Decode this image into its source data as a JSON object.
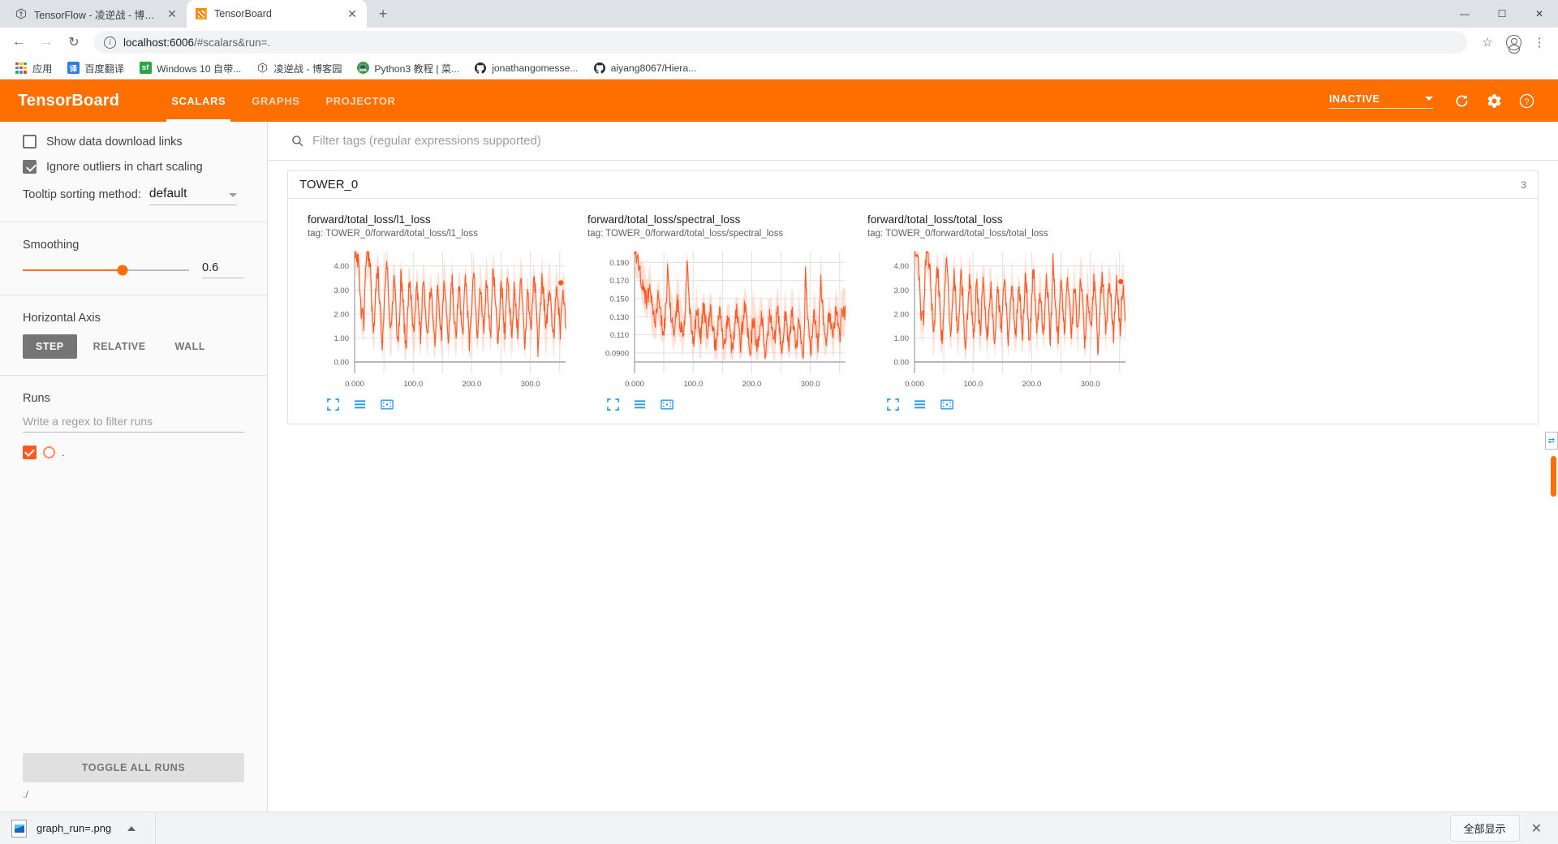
{
  "browser": {
    "tabs": [
      {
        "title": "TensorFlow - 凌逆战 - 博客园",
        "favicon": "tensorflow-icon",
        "active": false
      },
      {
        "title": "TensorBoard",
        "favicon": "tensorboard-icon",
        "active": true
      }
    ],
    "new_tab_label": "+",
    "window_controls": {
      "minimize": "—",
      "maximize": "☐",
      "close": "✕"
    },
    "nav": {
      "back": "←",
      "forward": "→",
      "reload": "↻"
    },
    "omnibox": {
      "url_host": "localhost:6006",
      "url_path": "/#scalars&run=.",
      "info_icon": "info-icon",
      "star_icon": "star-icon",
      "profile_icon": "profile-icon",
      "menu_icon": "kebab-menu-icon"
    },
    "bookmarks": [
      {
        "label": "应用",
        "icon": "apps-grid-icon"
      },
      {
        "label": "百度翻译",
        "icon": "baidu-translate-icon",
        "badge": "译"
      },
      {
        "label": "Windows 10 自带...",
        "icon": "sf-icon",
        "badge": "sf"
      },
      {
        "label": "凌逆战 - 博客园",
        "icon": "tensorflow-icon"
      },
      {
        "label": "Python3 教程 | 菜...",
        "icon": "runoob-icon"
      },
      {
        "label": "jonathangomesse...",
        "icon": "github-icon"
      },
      {
        "label": "aiyang8067/Hiera...",
        "icon": "github-icon"
      }
    ]
  },
  "tensorboard": {
    "logo": "TensorBoard",
    "nav": [
      {
        "label": "SCALARS",
        "active": true
      },
      {
        "label": "GRAPHS",
        "active": false
      },
      {
        "label": "PROJECTOR",
        "active": false
      }
    ],
    "status": "INACTIVE",
    "header_icons": [
      "refresh-icon",
      "settings-gear-icon",
      "help-icon"
    ]
  },
  "sidebar": {
    "checkboxes": [
      {
        "label": "Show data download links",
        "checked": false
      },
      {
        "label": "Ignore outliers in chart scaling",
        "checked": true
      }
    ],
    "tooltip_sorting": {
      "label": "Tooltip sorting method:",
      "value": "default"
    },
    "smoothing": {
      "title": "Smoothing",
      "value": "0.6",
      "percent": 60
    },
    "horizontal_axis": {
      "title": "Horizontal Axis",
      "options": [
        {
          "label": "STEP",
          "active": true
        },
        {
          "label": "RELATIVE",
          "active": false
        },
        {
          "label": "WALL",
          "active": false
        }
      ]
    },
    "runs": {
      "title": "Runs",
      "filter_placeholder": "Write a regex to filter runs",
      "items": [
        {
          "name": ".",
          "checked": true,
          "color": "#ff5722"
        }
      ]
    },
    "toggle_all_label": "TOGGLE ALL RUNS",
    "footer_path": "./"
  },
  "main": {
    "filter_placeholder": "Filter tags (regular expressions supported)",
    "search_icon": "search-icon",
    "card": {
      "title": "TOWER_0",
      "count": "3"
    },
    "chart_tools": [
      "expand-chart-icon",
      "data-series-icon",
      "fit-domain-icon"
    ]
  },
  "chart_data": [
    {
      "type": "line",
      "title": "forward/total_loss/l1_loss",
      "tag": "tag: TOWER_0/forward/total_loss/l1_loss",
      "xlabel": "",
      "ylabel": "",
      "xticks": [
        "0.000",
        "100.0",
        "200.0",
        "300.0"
      ],
      "yticks": [
        "0.00",
        "1.00",
        "2.00",
        "3.00",
        "4.00"
      ],
      "ylim": [
        0.0,
        4.6
      ],
      "xlim": [
        0,
        360
      ],
      "grid": true,
      "legend": false,
      "series_color": "#ff5722",
      "band_color": "#ffccbc",
      "last_point": {
        "x": 352,
        "y": 3.3
      },
      "series": [
        {
          "name": ".",
          "values": [
            4.55,
            4.6,
            4.4,
            4.2,
            3.0,
            1.75,
            2.1,
            1.6,
            3.6,
            4.5,
            4.45,
            4.3,
            3.9,
            2.4,
            1.25,
            1.3,
            2.8,
            3.9,
            3.5,
            2.6,
            1.35,
            0.85,
            1.9,
            3.2,
            4.3,
            3.7,
            2.2,
            1.1,
            1.4,
            2.7,
            3.5,
            2.9,
            1.5,
            0.95,
            1.8,
            3.6,
            3.1,
            2.3,
            1.2,
            0.6,
            1.7,
            2.9,
            3.4,
            2.5,
            1.45,
            1.0,
            2.0,
            3.3,
            2.6,
            1.6,
            1.1,
            2.4,
            3.2,
            2.8,
            1.9,
            1.05,
            1.5,
            2.7,
            3.0,
            2.2,
            1.3,
            0.9,
            2.1,
            3.1,
            2.5,
            1.7,
            1.2,
            2.6,
            3.4,
            2.9,
            1.8,
            0.55,
            1.6,
            2.8,
            3.3,
            2.4,
            1.4,
            0.95,
            2.2,
            3.0,
            2.7,
            1.55,
            1.1,
            2.3,
            3.6,
            2.95,
            1.85,
            0.6,
            1.45,
            2.5,
            3.9,
            3.2,
            2.0,
            1.15,
            1.9,
            3.05,
            2.6,
            1.65,
            1.25,
            2.45,
            3.5,
            2.85,
            1.75,
            1.0,
            2.15,
            4.2,
            3.15,
            2.35,
            1.35,
            0.9,
            2.05,
            3.25,
            2.75,
            1.6,
            1.2,
            2.55,
            3.45,
            2.9,
            1.95,
            1.05,
            1.8,
            3.1,
            2.65,
            1.7,
            1.15,
            2.3,
            3.55,
            3.0,
            2.1,
            0.75,
            1.5,
            2.85,
            2.45,
            1.85,
            1.3,
            2.6,
            3.35,
            2.95,
            2.0,
            0.45,
            1.4,
            2.4,
            3.5,
            3.05,
            2.25,
            1.1,
            1.95,
            2.7,
            3.2,
            2.55,
            1.5,
            0.95,
            2.1,
            3.4,
            2.8,
            1.9,
            1.2,
            2.35,
            3.1,
            2.65,
            1.75
          ]
        }
      ]
    },
    {
      "type": "line",
      "title": "forward/total_loss/spectral_loss",
      "tag": "tag: TOWER_0/forward/total_loss/spectral_loss",
      "xlabel": "",
      "ylabel": "",
      "xticks": [
        "0.000",
        "100.0",
        "200.0",
        "300.0"
      ],
      "yticks": [
        "0.0900",
        "0.110",
        "0.130",
        "0.150",
        "0.170",
        "0.190"
      ],
      "ylim": [
        0.08,
        0.202
      ],
      "xlim": [
        0,
        360
      ],
      "grid": true,
      "legend": false,
      "series_color": "#ff5722",
      "band_color": "#ffccbc",
      "series": [
        {
          "name": ".",
          "values": [
            0.2,
            0.199,
            0.197,
            0.188,
            0.178,
            0.172,
            0.165,
            0.158,
            0.15,
            0.146,
            0.155,
            0.162,
            0.148,
            0.14,
            0.133,
            0.128,
            0.138,
            0.152,
            0.145,
            0.131,
            0.12,
            0.115,
            0.125,
            0.143,
            0.185,
            0.16,
            0.139,
            0.127,
            0.118,
            0.112,
            0.13,
            0.148,
            0.136,
            0.124,
            0.116,
            0.108,
            0.122,
            0.141,
            0.195,
            0.158,
            0.134,
            0.121,
            0.111,
            0.105,
            0.119,
            0.137,
            0.129,
            0.117,
            0.11,
            0.126,
            0.144,
            0.132,
            0.12,
            0.113,
            0.123,
            0.14,
            0.128,
            0.114,
            0.104,
            0.098,
            0.109,
            0.127,
            0.135,
            0.121,
            0.106,
            0.095,
            0.108,
            0.124,
            0.131,
            0.118,
            0.103,
            0.092,
            0.107,
            0.123,
            0.138,
            0.126,
            0.112,
            0.099,
            0.115,
            0.133,
            0.142,
            0.13,
            0.117,
            0.102,
            0.094,
            0.111,
            0.129,
            0.122,
            0.108,
            0.096,
            0.105,
            0.125,
            0.134,
            0.12,
            0.101,
            0.088,
            0.104,
            0.119,
            0.132,
            0.127,
            0.113,
            0.098,
            0.11,
            0.128,
            0.137,
            0.116,
            0.1,
            0.091,
            0.109,
            0.131,
            0.124,
            0.107,
            0.097,
            0.114,
            0.136,
            0.126,
            0.112,
            0.093,
            0.106,
            0.129,
            0.121,
            0.105,
            0.09,
            0.103,
            0.187,
            0.14,
            0.118,
            0.102,
            0.095,
            0.115,
            0.133,
            0.125,
            0.109,
            0.099,
            0.12,
            0.18,
            0.145,
            0.127,
            0.111,
            0.098,
            0.117,
            0.135,
            0.128,
            0.113,
            0.101,
            0.123,
            0.142,
            0.13,
            0.119,
            0.108,
            0.132,
            0.139,
            0.134,
            0.136
          ]
        }
      ]
    },
    {
      "type": "line",
      "title": "forward/total_loss/total_loss",
      "tag": "tag: TOWER_0/forward/total_loss/total_loss",
      "xlabel": "",
      "ylabel": "",
      "xticks": [
        "0.000",
        "100.0",
        "200.0",
        "300.0"
      ],
      "yticks": [
        "0.00",
        "1.00",
        "2.00",
        "3.00",
        "4.00"
      ],
      "ylim": [
        0.0,
        4.6
      ],
      "xlim": [
        0,
        360
      ],
      "grid": true,
      "legend": false,
      "series_color": "#ff5722",
      "band_color": "#ffccbc",
      "last_point": {
        "x": 352,
        "y": 3.35
      },
      "series": [
        {
          "name": ".",
          "values": [
            4.6,
            4.5,
            4.3,
            4.1,
            2.9,
            1.8,
            2.2,
            1.7,
            3.7,
            4.55,
            4.4,
            4.2,
            3.8,
            2.5,
            1.35,
            1.4,
            2.9,
            3.95,
            3.55,
            2.65,
            1.45,
            0.9,
            2.0,
            3.25,
            4.35,
            3.75,
            2.3,
            1.2,
            1.5,
            2.75,
            3.55,
            2.95,
            1.6,
            1.0,
            1.85,
            3.65,
            3.15,
            2.35,
            1.25,
            0.7,
            1.75,
            2.95,
            3.45,
            2.55,
            1.5,
            1.05,
            2.05,
            3.35,
            2.65,
            1.65,
            1.15,
            2.45,
            3.25,
            2.85,
            1.95,
            1.1,
            1.55,
            2.75,
            3.05,
            2.25,
            1.35,
            0.95,
            2.15,
            3.15,
            2.55,
            1.75,
            1.25,
            2.65,
            3.45,
            2.95,
            1.85,
            0.6,
            1.65,
            2.85,
            3.35,
            2.45,
            1.45,
            1.0,
            2.25,
            3.05,
            2.75,
            1.6,
            1.15,
            2.35,
            3.65,
            3.0,
            1.9,
            0.65,
            1.5,
            2.55,
            3.95,
            3.25,
            2.05,
            1.2,
            1.95,
            3.1,
            2.65,
            1.7,
            1.3,
            2.5,
            3.55,
            2.9,
            1.8,
            1.05,
            2.2,
            4.25,
            3.2,
            2.4,
            1.4,
            0.95,
            2.1,
            3.3,
            2.8,
            1.65,
            1.25,
            2.6,
            3.5,
            2.95,
            2.0,
            1.1,
            1.85,
            3.15,
            2.7,
            1.75,
            1.2,
            2.35,
            3.6,
            3.05,
            2.15,
            0.8,
            1.55,
            2.9,
            2.5,
            1.9,
            1.35,
            2.65,
            3.4,
            3.0,
            2.05,
            0.5,
            1.45,
            2.45,
            3.55,
            3.1,
            2.3,
            1.15,
            2.0,
            2.75,
            3.25,
            2.6,
            1.55,
            1.0,
            2.15,
            3.45,
            2.85,
            1.95,
            1.25,
            2.4,
            3.15,
            2.7,
            1.8
          ]
        }
      ]
    }
  ],
  "download_bar": {
    "file_name": "graph_run=.png",
    "show_all_label": "全部显示",
    "close_label": "✕"
  }
}
